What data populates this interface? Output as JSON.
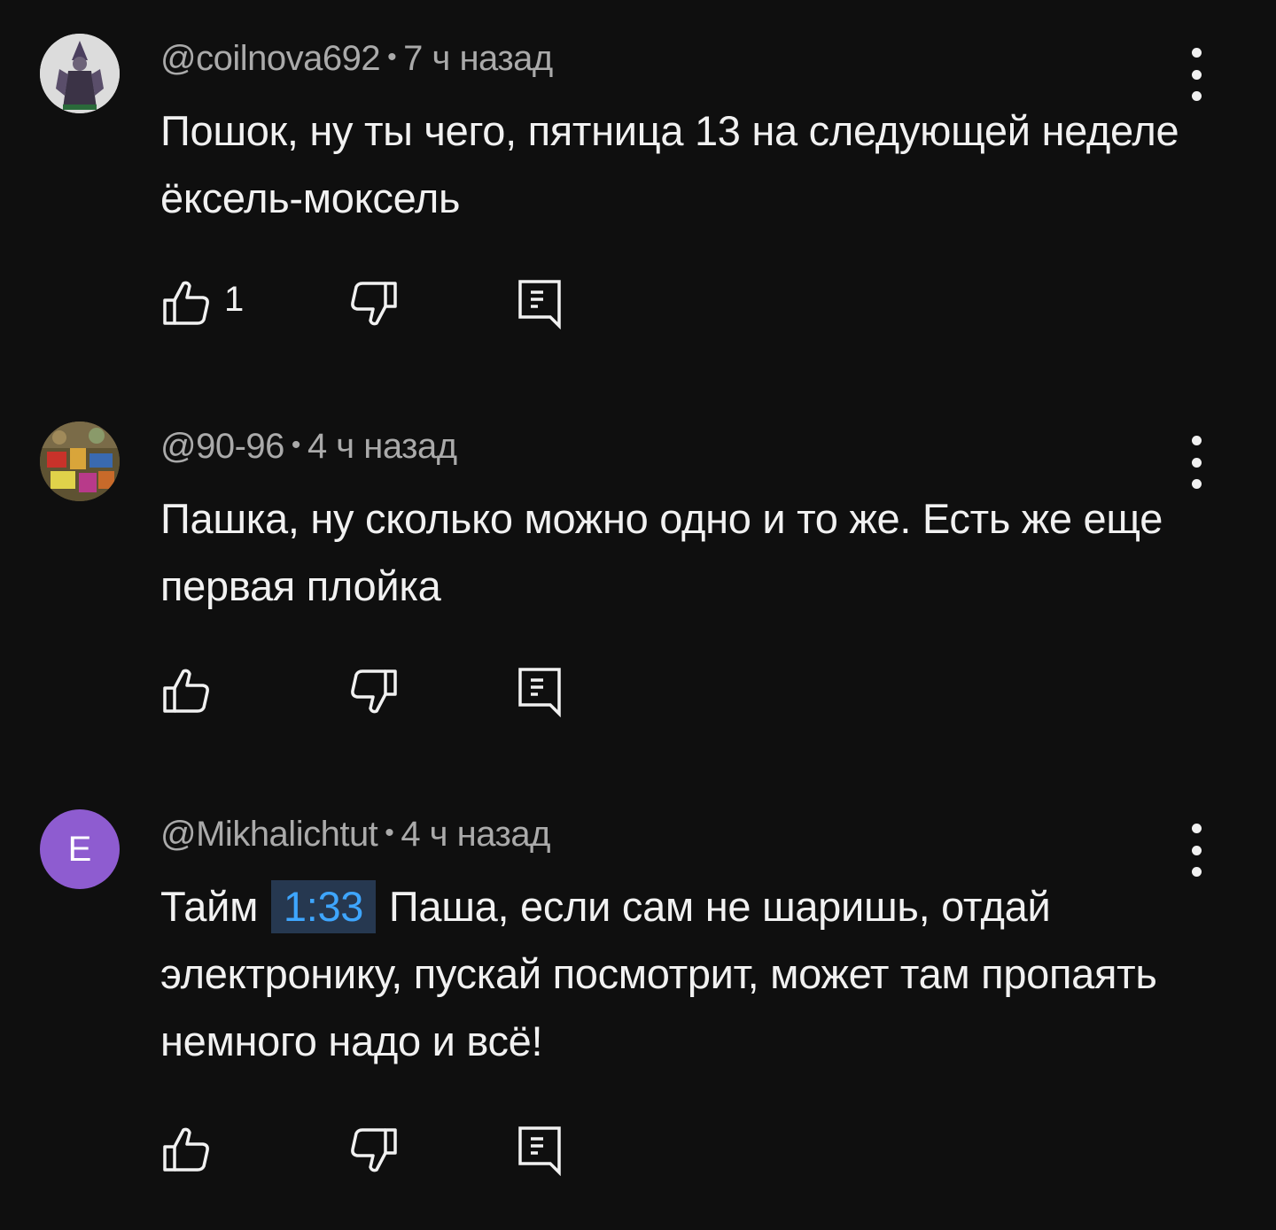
{
  "comments": [
    {
      "author": "@coilnova692",
      "separator": "•",
      "time": "7 ч назад",
      "text": "Пошок, ну ты чего, пятница 13 на следующей неделе ёксель-моксель",
      "likes": "1",
      "avatar": {
        "type": "image",
        "description": "costumed-figure-avatar",
        "bg": "#d9d9d9"
      }
    },
    {
      "author": "@90-96",
      "separator": "•",
      "time": "4 ч назад",
      "text": "Пашка, ну сколько можно одно и то же. Есть же еще первая плойка",
      "likes": "",
      "avatar": {
        "type": "image",
        "description": "toys-collage-avatar",
        "bg": "#6b5a3a"
      }
    },
    {
      "author": "@Mikhalichtut",
      "separator": "•",
      "time": "4 ч назад",
      "text_before": "Тайм",
      "timestamp_link": "1:33",
      "text_after": "Паша, если сам не шаришь, отдай электронику, пускай посмотрит, может там пропаять немного надо и всё!",
      "likes": "",
      "avatar": {
        "type": "letter",
        "letter": "E",
        "bg": "#8e5cd0"
      }
    }
  ],
  "icons": {
    "like": "thumb-up-icon",
    "dislike": "thumb-down-icon",
    "reply": "reply-comment-icon",
    "menu": "more-vert-icon"
  },
  "colors": {
    "background": "#0f0f0f",
    "text": "#f1f1f1",
    "meta": "#aaaaaa",
    "link": "#3ea6ff",
    "link_bg": "#263850"
  }
}
